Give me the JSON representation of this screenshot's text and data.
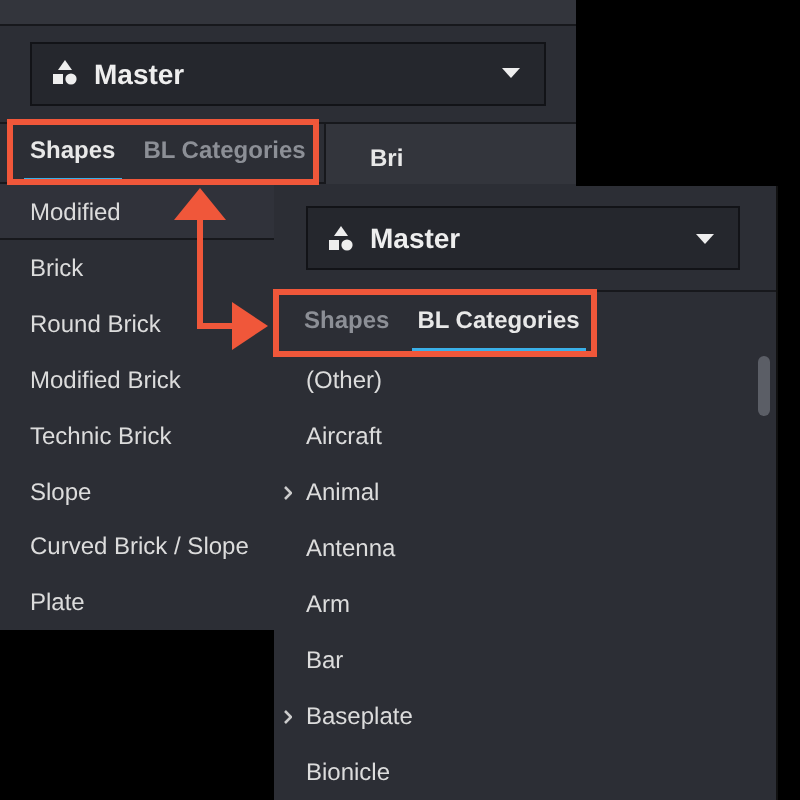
{
  "back_panel": {
    "dropdown": {
      "value": "Master"
    },
    "tabs": [
      {
        "label": "Shapes",
        "selected": true
      },
      {
        "label": "BL Categories",
        "selected": false
      }
    ],
    "side_header": "Bri",
    "items": [
      {
        "label": "Modified",
        "selected": true
      },
      {
        "label": "Brick",
        "selected": false
      },
      {
        "label": "Round Brick",
        "selected": false
      },
      {
        "label": "Modified Brick",
        "selected": false
      },
      {
        "label": "Technic Brick",
        "selected": false
      },
      {
        "label": "Slope",
        "selected": false
      },
      {
        "label": "Curved Brick / Slope",
        "selected": false
      },
      {
        "label": "Plate",
        "selected": false
      }
    ]
  },
  "front_panel": {
    "dropdown": {
      "value": "Master"
    },
    "tabs": [
      {
        "label": "Shapes",
        "selected": false
      },
      {
        "label": "BL Categories",
        "selected": true
      }
    ],
    "items": [
      {
        "label": "(Other)",
        "expandable": false
      },
      {
        "label": "Aircraft",
        "expandable": false
      },
      {
        "label": "Animal",
        "expandable": true
      },
      {
        "label": "Antenna",
        "expandable": false
      },
      {
        "label": "Arm",
        "expandable": false
      },
      {
        "label": "Bar",
        "expandable": false
      },
      {
        "label": "Baseplate",
        "expandable": true
      },
      {
        "label": "Bionicle",
        "expandable": false
      }
    ]
  }
}
